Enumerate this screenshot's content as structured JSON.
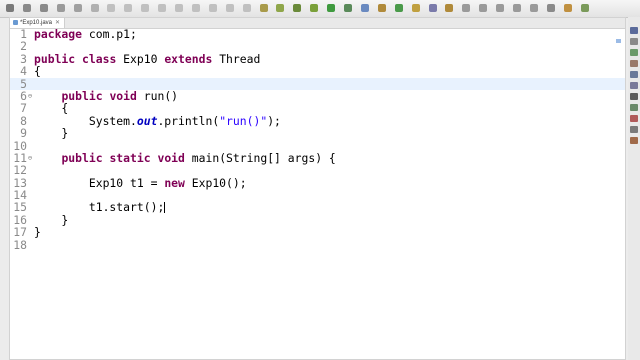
{
  "editor": {
    "tab": {
      "title": "*Exp10.java",
      "close_symbol": "✕"
    }
  },
  "code": {
    "current_line": 5,
    "lines": [
      {
        "num": "1",
        "fold": "",
        "html": "<span class='kw'>package</span> com.p1;"
      },
      {
        "num": "2",
        "fold": "",
        "html": ""
      },
      {
        "num": "3",
        "fold": "",
        "html": "<span class='kw'>public</span> <span class='kw'>class</span> Exp10 <span class='kw'>extends</span> Thread"
      },
      {
        "num": "4",
        "fold": "",
        "html": "{"
      },
      {
        "num": "5",
        "fold": "",
        "html": ""
      },
      {
        "num": "6",
        "fold": "⊖",
        "html": "    <span class='kw'>public</span> <span class='kw'>void</span> run()"
      },
      {
        "num": "7",
        "fold": "",
        "html": "    {"
      },
      {
        "num": "8",
        "fold": "",
        "html": "        System.<span class='fld'>out</span>.println(<span class='str'>\"run()\"</span>);"
      },
      {
        "num": "9",
        "fold": "",
        "html": "    }"
      },
      {
        "num": "10",
        "fold": "",
        "html": ""
      },
      {
        "num": "11",
        "fold": "⊖",
        "html": "    <span class='kw'>public</span> <span class='kw'>static</span> <span class='kw'>void</span> main(String[] args) {"
      },
      {
        "num": "12",
        "fold": "",
        "html": ""
      },
      {
        "num": "13",
        "fold": "",
        "html": "        Exp10 t1 = <span class='kw'>new</span> Exp10();"
      },
      {
        "num": "14",
        "fold": "",
        "html": ""
      },
      {
        "num": "15",
        "fold": "",
        "html": "        t1.start();<span class='caret' data-name='text-cursor' data-interactable='false'></span>"
      },
      {
        "num": "16",
        "fold": "",
        "html": "    }"
      },
      {
        "num": "17",
        "fold": "",
        "html": "}"
      },
      {
        "num": "18",
        "fold": "",
        "html": ""
      }
    ]
  },
  "toolbar": {
    "icons": [
      {
        "name": "new-icon",
        "color": "#7a7a7a"
      },
      {
        "name": "save-icon",
        "color": "#8a8a8a"
      },
      {
        "name": "save-all-icon",
        "color": "#8a8a8a"
      },
      {
        "name": "print-icon",
        "color": "#9a9a9a"
      },
      {
        "name": "cut-icon",
        "color": "#a0a0a0"
      },
      {
        "name": "skip-breakpoints-icon",
        "color": "#b0b0b0"
      },
      {
        "name": "resume-icon",
        "color": "#c0c0c0"
      },
      {
        "name": "suspend-icon",
        "color": "#c0c0c0"
      },
      {
        "name": "terminate-icon",
        "color": "#c0c0c0"
      },
      {
        "name": "disconnect-icon",
        "color": "#c0c0c0"
      },
      {
        "name": "step-into-icon",
        "color": "#c0c0c0"
      },
      {
        "name": "step-over-icon",
        "color": "#c0c0c0"
      },
      {
        "name": "step-return-icon",
        "color": "#c0c0c0"
      },
      {
        "name": "drop-frame-icon",
        "color": "#c0c0c0"
      },
      {
        "name": "use-step-filters-icon",
        "color": "#c0c0c0"
      },
      {
        "name": "toggle-breadcrumb-icon",
        "color": "#a89a4a"
      },
      {
        "name": "mark-occurrences-icon",
        "color": "#8fa64a"
      },
      {
        "name": "debug-icon",
        "color": "#6a8a3a"
      },
      {
        "name": "coverage-icon",
        "color": "#7aa03a"
      },
      {
        "name": "run-icon",
        "color": "#3f9a3f"
      },
      {
        "name": "external-tools-icon",
        "color": "#5a8a5a"
      },
      {
        "name": "new-java-project-icon",
        "color": "#6a8ac0"
      },
      {
        "name": "new-package-icon",
        "color": "#b08a3a"
      },
      {
        "name": "new-class-icon",
        "color": "#4a9a4a"
      },
      {
        "name": "open-type-icon",
        "color": "#c0a040"
      },
      {
        "name": "open-task-icon",
        "color": "#7a7aaa"
      },
      {
        "name": "search-icon",
        "color": "#b08a3a"
      },
      {
        "name": "annotation-next-icon",
        "color": "#9a9a9a"
      },
      {
        "name": "annotation-prev-icon",
        "color": "#9a9a9a"
      },
      {
        "name": "last-edit-location-icon",
        "color": "#9a9a9a"
      },
      {
        "name": "back-icon",
        "color": "#9a9a9a"
      },
      {
        "name": "forward-icon",
        "color": "#9a9a9a"
      },
      {
        "name": "quick-access-icon",
        "color": "#8a8a8a"
      },
      {
        "name": "java-perspective-icon",
        "color": "#c09040"
      },
      {
        "name": "debug-perspective-icon",
        "color": "#7a9a5a"
      }
    ]
  },
  "sidebar": {
    "icons": [
      {
        "name": "outline-icon",
        "color": "#5a6a9a"
      },
      {
        "name": "task-list-icon",
        "color": "#8a8a8a"
      },
      {
        "name": "hierarchy-icon",
        "color": "#6a9a6a"
      },
      {
        "name": "problems-icon",
        "color": "#9a7a6a"
      },
      {
        "name": "javadoc-icon",
        "color": "#6a7a9a"
      },
      {
        "name": "declaration-icon",
        "color": "#7a7a9a"
      },
      {
        "name": "console-icon",
        "color": "#5a5a5a"
      },
      {
        "name": "progress-icon",
        "color": "#6a8a6a"
      },
      {
        "name": "error-log-icon",
        "color": "#b05a5a"
      },
      {
        "name": "servers-icon",
        "color": "#7a7a7a"
      },
      {
        "name": "git-icon",
        "color": "#a06a4a"
      }
    ]
  }
}
